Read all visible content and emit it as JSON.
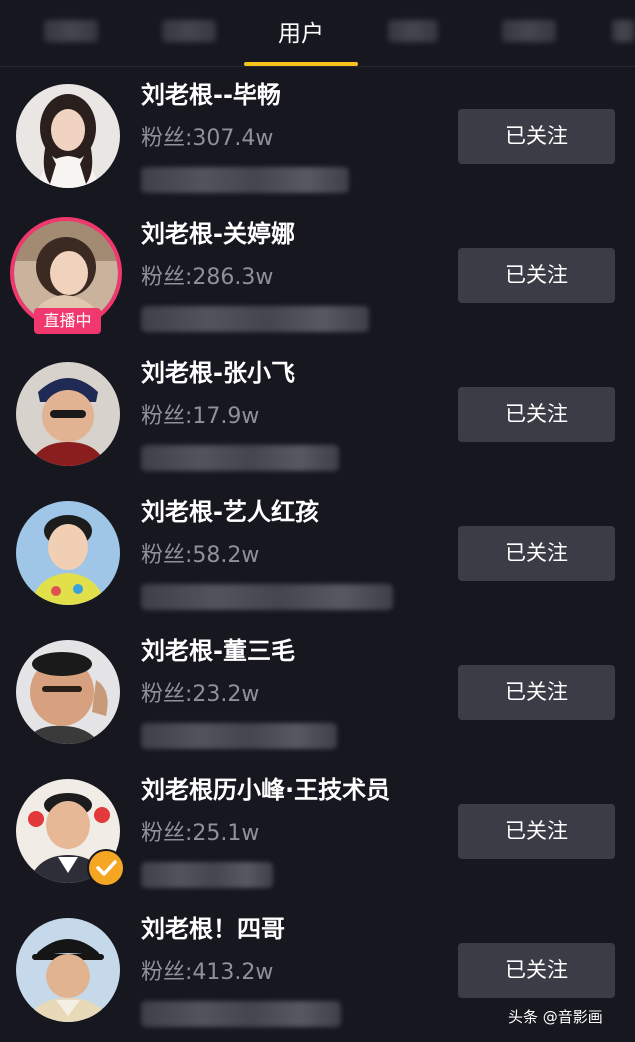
{
  "tabs": {
    "active_label": "用户"
  },
  "users": [
    {
      "name": "刘老根--毕畅",
      "fans": "粉丝:307.4w",
      "button": "已关注",
      "live": false,
      "verified": false
    },
    {
      "name": "刘老根-关婷娜",
      "fans": "粉丝:286.3w",
      "button": "已关注",
      "live": true,
      "live_label": "直播中",
      "verified": false
    },
    {
      "name": "刘老根-张小飞",
      "fans": "粉丝:17.9w",
      "button": "已关注",
      "live": false,
      "verified": false
    },
    {
      "name": "刘老根-艺人红孩",
      "fans": "粉丝:58.2w",
      "button": "已关注",
      "live": false,
      "verified": false
    },
    {
      "name": "刘老根-董三毛",
      "fans": "粉丝:23.2w",
      "button": "已关注",
      "live": false,
      "verified": false
    },
    {
      "name": "刘老根历小峰·王技术员",
      "fans": "粉丝:25.1w",
      "button": "已关注",
      "live": false,
      "verified": true
    },
    {
      "name": "刘老根！四哥",
      "fans": "粉丝:413.2w",
      "button": "已关注",
      "live": false,
      "verified": false
    }
  ],
  "watermark": "头条 @音影画",
  "colors": {
    "background": "#16171f",
    "tab_indicator": "#f7c21a",
    "live": "#f0386e",
    "verified": "#f5a623",
    "button_bg": "#3b3c46"
  }
}
